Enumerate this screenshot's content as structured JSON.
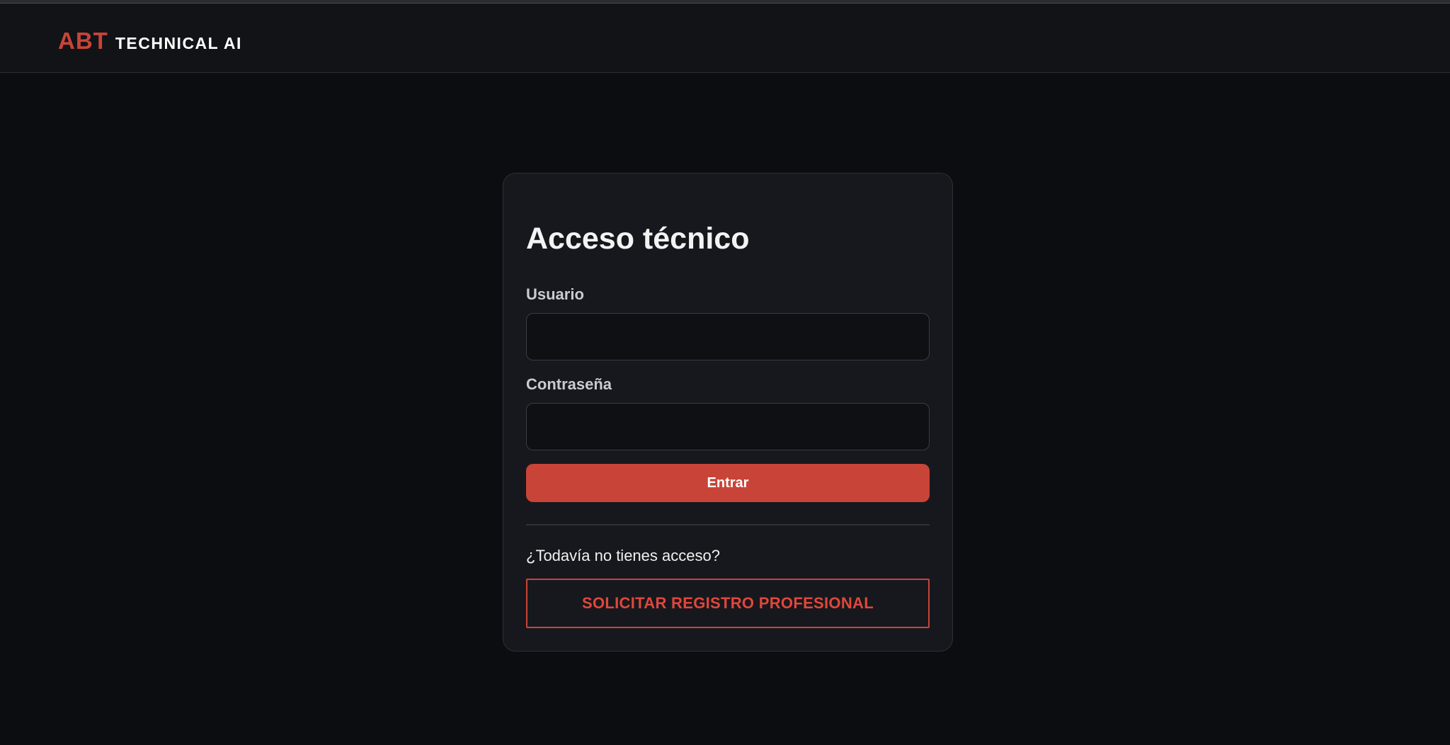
{
  "brand": {
    "abt": "ABT",
    "rest": "TECHNICAL AI"
  },
  "login": {
    "title": "Acceso técnico",
    "user_label": "Usuario",
    "user_value": "",
    "password_label": "Contraseña",
    "password_value": "",
    "submit_label": "Entrar",
    "no_access_text": "¿Todavía no tienes acceso?",
    "register_label": "SOLICITAR REGISTRO PROFESIONAL"
  },
  "colors": {
    "accent": "#c94438",
    "background": "#0b0d11",
    "card": "#17181d"
  }
}
